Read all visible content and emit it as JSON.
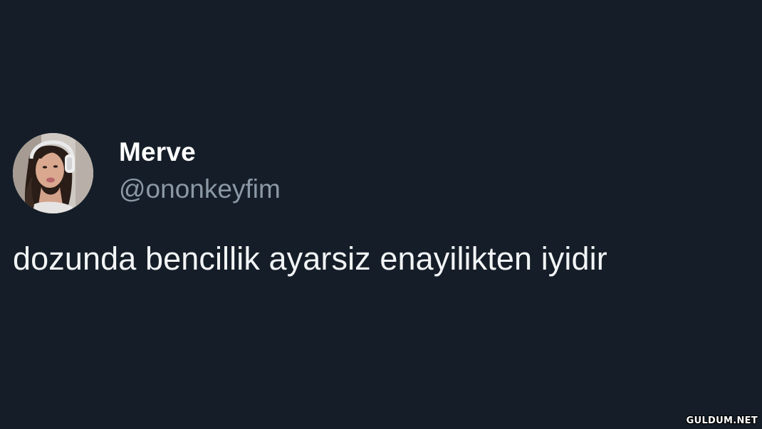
{
  "colors": {
    "background": "#151e28",
    "name": "#ffffff",
    "handle": "#8b98a5",
    "text": "#f2f4f6"
  },
  "author": {
    "display_name": "Merve",
    "handle": "@ononkeyfim",
    "avatar_icon": "profile-photo-avatar"
  },
  "tweet": {
    "text": "dozunda bencillik ayarsiz enayilikten iyidir"
  },
  "watermark": {
    "text": "GULDUM.NET"
  }
}
